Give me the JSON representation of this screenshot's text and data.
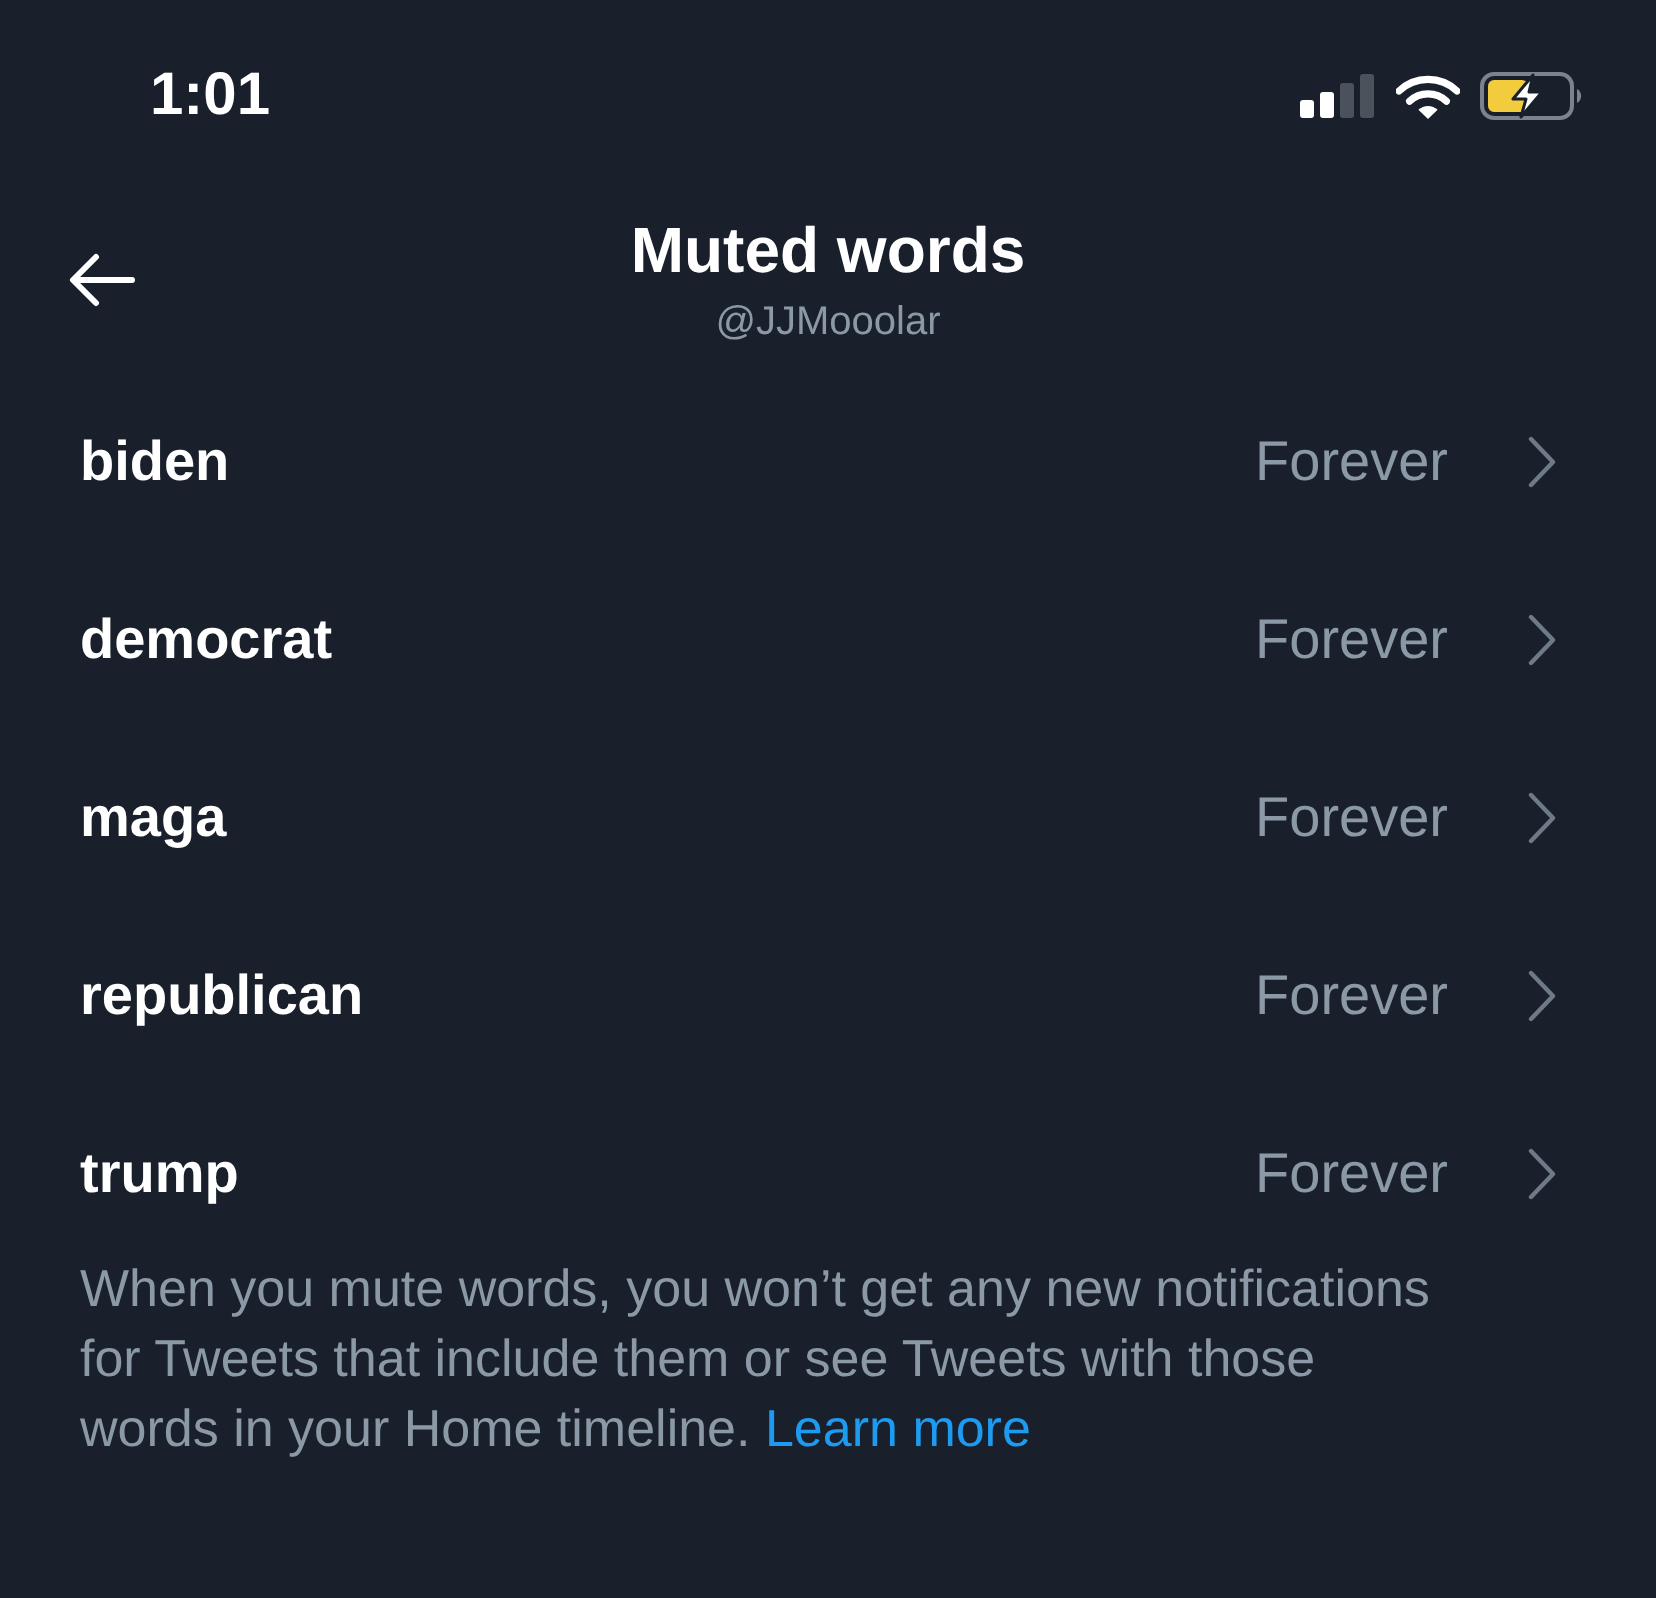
{
  "status_bar": {
    "time": "1:01"
  },
  "header": {
    "title": "Muted words",
    "handle": "@JJMooolar"
  },
  "muted_words": [
    {
      "word": "biden",
      "duration": "Forever"
    },
    {
      "word": "democrat",
      "duration": "Forever"
    },
    {
      "word": "maga",
      "duration": "Forever"
    },
    {
      "word": "republican",
      "duration": "Forever"
    },
    {
      "word": "trump",
      "duration": "Forever"
    }
  ],
  "footer": {
    "text": "When you mute words, you won’t get any new notifications for Tweets that include them or see Tweets with those words in your Home timeline.",
    "link": "Learn more"
  }
}
